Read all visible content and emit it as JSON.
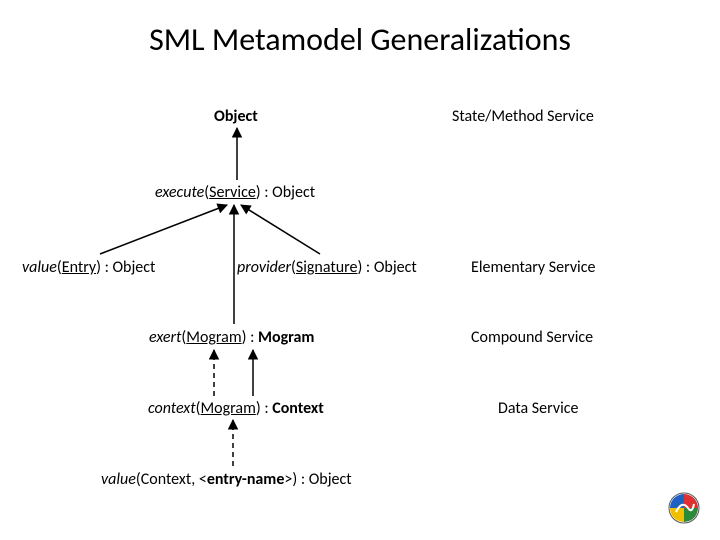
{
  "title": "SML Metamodel Generalizations",
  "nodes": {
    "object": "Object",
    "state_method_service": "State/Method Service",
    "execute_pre": "execute",
    "execute_mid": "(",
    "execute_arg": "Service",
    "execute_post": ") : Object",
    "value_entry_pre": "value",
    "value_entry_mid": "(",
    "value_entry_arg": "Entry",
    "value_entry_post": ") : Object",
    "provider_pre": "provider",
    "provider_mid": "(",
    "provider_arg": "Signature",
    "provider_post": ") : Object",
    "elementary_service": "Elementary Service",
    "exert_pre": "exert",
    "exert_mid": "(",
    "exert_arg": "Mogram",
    "exert_post": ") : ",
    "exert_ret": "Mogram",
    "compound_service": "Compound Service",
    "context_pre": "context",
    "context_mid": "(",
    "context_arg": "Mogram",
    "context_post": ") : ",
    "context_ret": "Context",
    "data_service": "Data Service",
    "value_ctx_pre": "value",
    "value_ctx_mid": "(Context, <",
    "value_ctx_arg": "entry-name",
    "value_ctx_post": ">) : Object"
  }
}
